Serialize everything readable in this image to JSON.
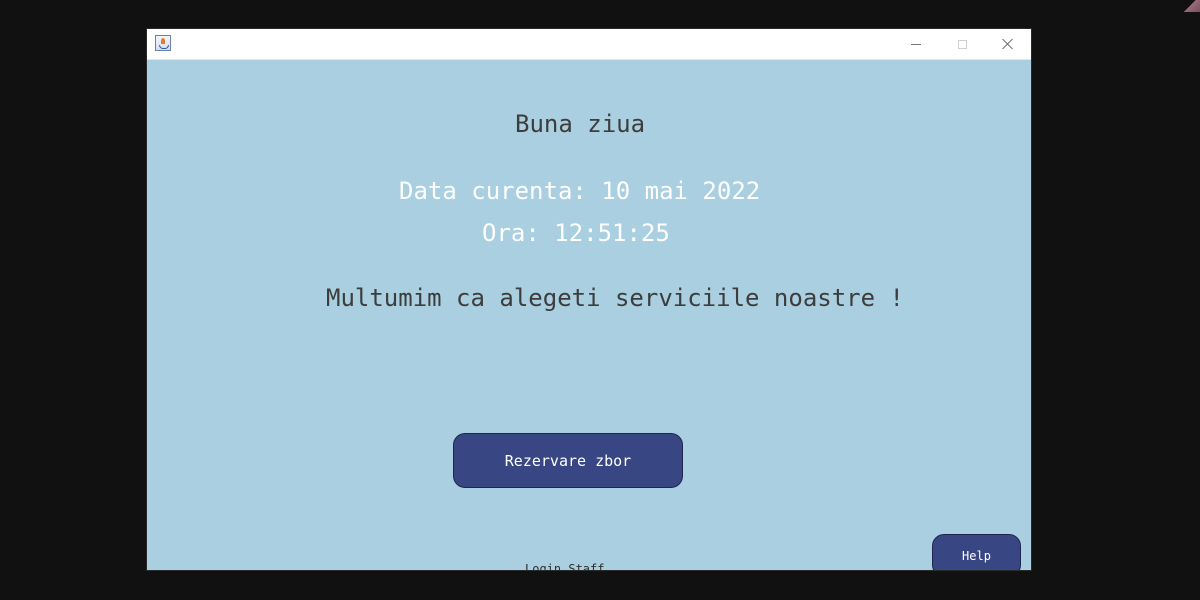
{
  "window": {
    "icon": "java-cup-icon",
    "controls": [
      "minimize-icon",
      "maximize-icon",
      "close-icon"
    ]
  },
  "content": {
    "greeting": "Buna ziua",
    "date_text": "Data curenta: 10 mai 2022",
    "time_text": "Ora: 12:51:25",
    "thanks_text": "Multumim ca alegeti serviciile noastre !",
    "primary_button": "Rezervare zbor",
    "staff_link": "Login Staff",
    "help_button": "Help"
  },
  "colors": {
    "background": "#a9cfe0",
    "button": "#384684",
    "title_text": "#3d3d3d",
    "highlight_text": "#ffffff"
  }
}
